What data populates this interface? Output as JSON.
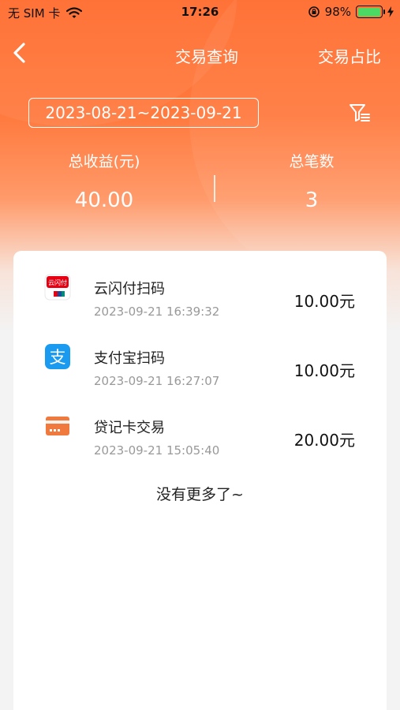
{
  "status_bar": {
    "carrier": "无 SIM 卡",
    "time": "17:26",
    "battery_percent": "98%",
    "battery_level": 0.98
  },
  "nav": {
    "title": "交易查询",
    "right_label": "交易占比"
  },
  "filter": {
    "date_range": "2023-08-21~2023-09-21"
  },
  "summary": {
    "income_label": "总收益(元)",
    "income_value": "40.00",
    "count_label": "总笔数",
    "count_value": "3"
  },
  "transactions": [
    {
      "name": "云闪付扫码",
      "time": "2023-09-21 16:39:32",
      "amount": "10.00元",
      "icon": "unionpay-quickpass-icon",
      "icon_text": "云闪付"
    },
    {
      "name": "支付宝扫码",
      "time": "2023-09-21 16:27:07",
      "amount": "10.00元",
      "icon": "alipay-icon",
      "icon_text": "支"
    },
    {
      "name": "贷记卡交易",
      "time": "2023-09-21 15:05:40",
      "amount": "20.00元",
      "icon": "credit-card-icon"
    }
  ],
  "list_footer": "没有更多了~",
  "colors": {
    "accent": "#ff6a2b",
    "unionpay_red": "#e60012",
    "alipay_blue": "#1a9bf0",
    "card_orange": "#f07a3d"
  }
}
